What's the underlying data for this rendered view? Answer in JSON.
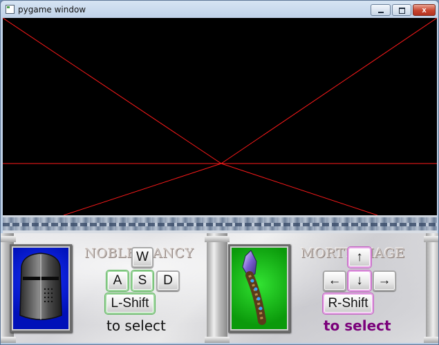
{
  "window": {
    "title": "pygame window",
    "controls": {
      "minimize": "",
      "maximize": "",
      "close": "x"
    }
  },
  "viewport": {
    "background": "#000000",
    "line_color": "#ff0000"
  },
  "players": [
    {
      "name": "NOBLE NANCY",
      "portrait": "knight-helmet",
      "portrait_bg": "#0016d0",
      "keys": {
        "up": "W",
        "left": "A",
        "down": "S",
        "right": "D",
        "select": "L-Shift"
      },
      "select_hint": "to select",
      "highlight": "green"
    },
    {
      "name": "MORTY_MAGE",
      "portrait": "crystal-staff",
      "portrait_bg": "#12b512",
      "keys": {
        "up": "↑",
        "left": "←",
        "down": "↓",
        "right": "→",
        "select": "R-Shift"
      },
      "select_hint": "to select",
      "highlight": "magenta"
    }
  ]
}
